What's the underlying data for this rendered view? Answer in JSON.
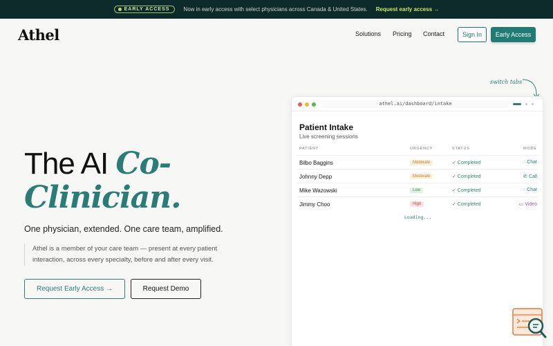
{
  "announcement": {
    "badge": "EARLY ACCESS",
    "message": "Now in early access with select physicians across Canada & United States.",
    "link": "Request early access →"
  },
  "nav": {
    "logo": "Athel",
    "items": [
      "Solutions",
      "Pricing",
      "Contact"
    ],
    "sign_in": "Sign In",
    "early_access": "Early Access"
  },
  "hero": {
    "title_plain": "The AI ",
    "title_accent": "Co-Clinician.",
    "tagline": "One physician, extended. One care team, amplified.",
    "description": "Athel is a member of your care team — present at every patient interaction, across every specialty, before and after every visit.",
    "cta_primary": "Request Early Access →",
    "cta_secondary": "Request Demo"
  },
  "hint": "switch tabs",
  "dashboard": {
    "url": "athel.ai/dashboard/intake",
    "title": "Patient Intake",
    "subtitle": "Live screening sessions",
    "columns": [
      "PATIENT",
      "URGENCY",
      "STATUS",
      "MODE"
    ],
    "rows": [
      {
        "patient": "Bilbo Baggins",
        "urgency": "Moderate",
        "status": "✓ Completed",
        "mode": "Chat"
      },
      {
        "patient": "Johnny Depp",
        "urgency": "Moderate",
        "status": "✓ Completed",
        "mode": "Call"
      },
      {
        "patient": "Mike Wazowski",
        "urgency": "Low",
        "status": "✓ Completed",
        "mode": "Chat"
      },
      {
        "patient": "Jimmy Choo",
        "urgency": "High",
        "status": "✓ Completed",
        "mode": "Video"
      }
    ],
    "loading": "Loading..."
  },
  "colors": {
    "brand": "#2a7c76",
    "topbar_bg": "#0d2a2a",
    "accent_link": "#c6ea62"
  }
}
